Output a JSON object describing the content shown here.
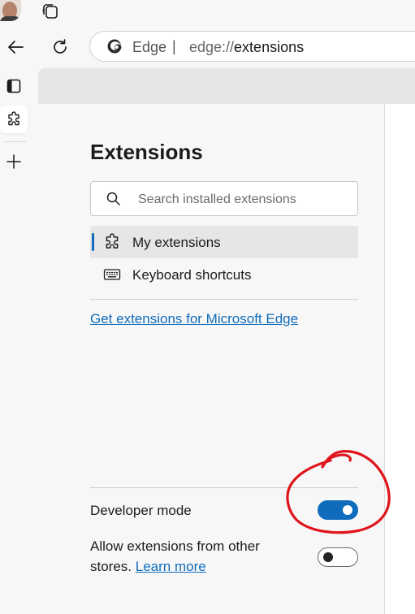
{
  "browser": {
    "address_bar": {
      "site_label": "Edge",
      "separator": "|",
      "url_scheme": "edge://",
      "url_path": "extensions"
    }
  },
  "page": {
    "title": "Extensions",
    "search": {
      "placeholder": "Search installed extensions",
      "value": ""
    },
    "menu": [
      {
        "label": "My extensions",
        "icon": "puzzle-icon",
        "selected": true
      },
      {
        "label": "Keyboard shortcuts",
        "icon": "keyboard-icon",
        "selected": false
      }
    ],
    "get_extensions_link": "Get extensions for Microsoft Edge",
    "settings": {
      "developer_mode": {
        "label": "Developer mode",
        "enabled": true
      },
      "other_stores": {
        "label": "Allow extensions from other stores.",
        "link": "Learn more",
        "enabled": false
      }
    }
  },
  "colors": {
    "accent": "#0f6cbd",
    "annotation": "#e0141c",
    "page_background": "#f7f7f7"
  }
}
